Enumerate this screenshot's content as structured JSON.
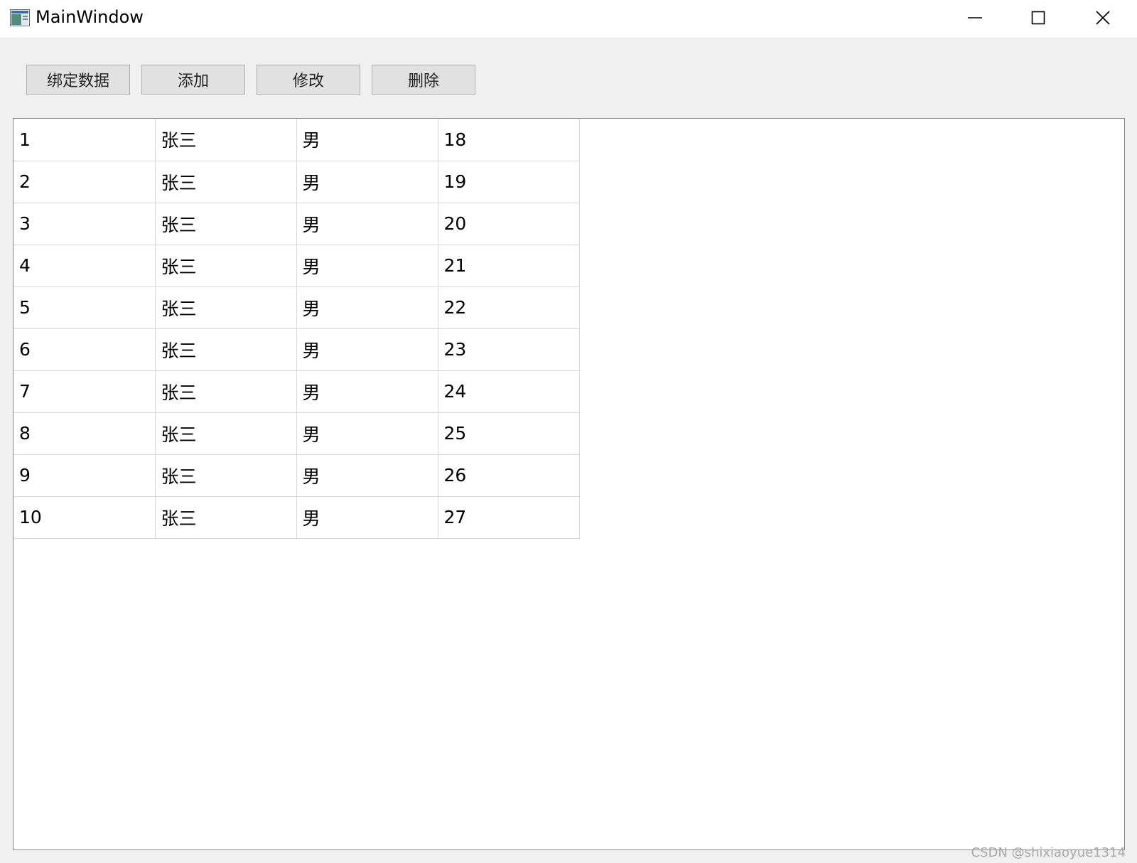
{
  "window": {
    "title": "MainWindow",
    "icon": "app-window-icon"
  },
  "window_controls": [
    {
      "name": "minimize-icon"
    },
    {
      "name": "maximize-icon"
    },
    {
      "name": "close-icon"
    }
  ],
  "toolbar": {
    "bind_label": "绑定数据",
    "add_label": "添加",
    "edit_label": "修改",
    "delete_label": "删除"
  },
  "table": {
    "rows": [
      [
        "1",
        "张三",
        "男",
        "18"
      ],
      [
        "2",
        "张三",
        "男",
        "19"
      ],
      [
        "3",
        "张三",
        "男",
        "20"
      ],
      [
        "4",
        "张三",
        "男",
        "21"
      ],
      [
        "5",
        "张三",
        "男",
        "22"
      ],
      [
        "6",
        "张三",
        "男",
        "23"
      ],
      [
        "7",
        "张三",
        "男",
        "24"
      ],
      [
        "8",
        "张三",
        "男",
        "25"
      ],
      [
        "9",
        "张三",
        "男",
        "26"
      ],
      [
        "10",
        "张三",
        "男",
        "27"
      ]
    ]
  },
  "watermark": "CSDN @shixiaoyue1314"
}
